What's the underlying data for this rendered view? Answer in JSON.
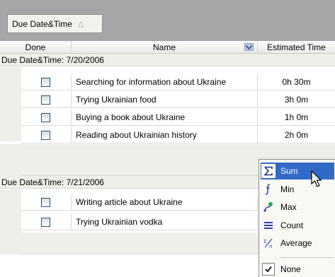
{
  "group_panel": {
    "chip_label": "Due Date&Time",
    "sort_indicator": "△"
  },
  "columns": {
    "done": "Done",
    "name": "Name",
    "estimated": "Estimated Time"
  },
  "groups": [
    {
      "label": "Due Date&Time: 7/20/2006",
      "rows": [
        {
          "done": false,
          "name": "Searching for information about Ukraine",
          "estimated": "0h 30m"
        },
        {
          "done": false,
          "name": "Trying Ukrainian food",
          "estimated": "3h 0m"
        },
        {
          "done": false,
          "name": "Buying a book about Ukraine",
          "estimated": "1h 0m"
        },
        {
          "done": false,
          "name": "Reading about Ukrainian history",
          "estimated": "2h 0m"
        }
      ]
    },
    {
      "label": "Due Date&Time: 7/21/2006",
      "rows": [
        {
          "done": false,
          "name": "Writing article about Ukraine",
          "estimated": ""
        },
        {
          "done": false,
          "name": "Trying Ukrainian vodka",
          "estimated": ""
        }
      ]
    }
  ],
  "summary_menu": {
    "items": [
      {
        "label": "Sum",
        "icon": "sigma-icon",
        "selected": true
      },
      {
        "label": "Min",
        "icon": "min-icon",
        "selected": false
      },
      {
        "label": "Max",
        "icon": "max-icon",
        "selected": false
      },
      {
        "label": "Count",
        "icon": "count-icon",
        "selected": false
      },
      {
        "label": "Average",
        "icon": "average-icon",
        "selected": false
      }
    ],
    "none_label": "None",
    "none_checked": true
  },
  "colors": {
    "group_panel_bg": "#a6a6a6",
    "group_row_bg": "#efeee8",
    "selection": "#3169c6"
  }
}
